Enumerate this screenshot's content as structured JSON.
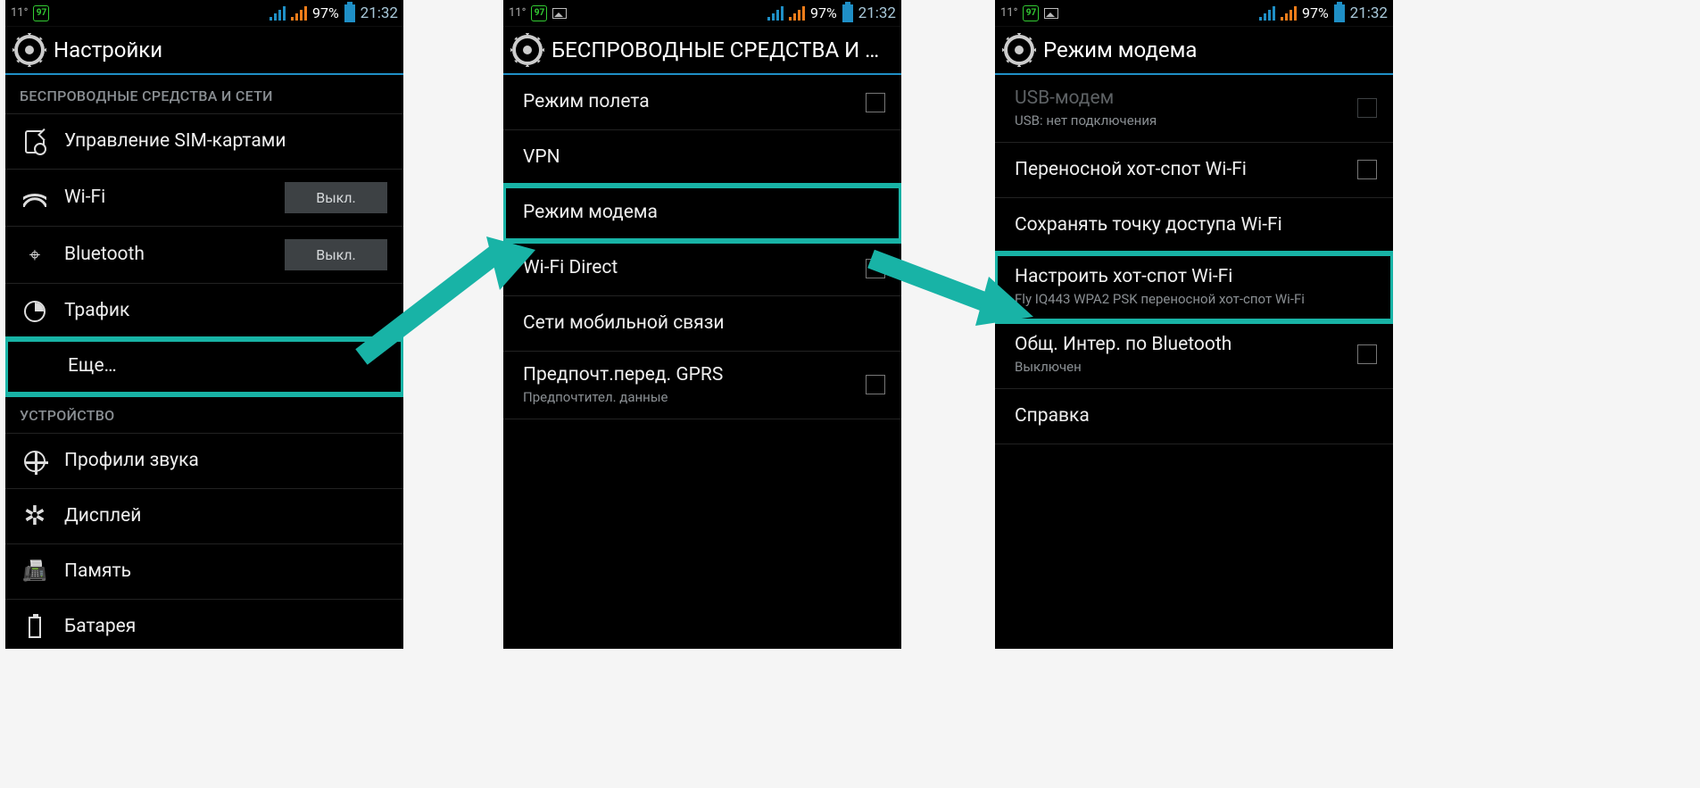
{
  "status": {
    "temp": "11°",
    "badge": "97",
    "battery_pct": "97%",
    "time": "21:32"
  },
  "screens": [
    {
      "title": "Настройки",
      "showPicIcon": false,
      "sections": [
        {
          "header": "БЕСПРОВОДНЫЕ СРЕДСТВА И СЕТИ",
          "items": [
            {
              "icon": "sim",
              "label": "Управление SIM-картами"
            },
            {
              "icon": "wifi",
              "label": "Wi-Fi",
              "toggle": "Выкл."
            },
            {
              "icon": "bt",
              "label": "Bluetooth",
              "toggle": "Выкл."
            },
            {
              "icon": "data",
              "label": "Трафик"
            },
            {
              "icon": "",
              "label": "Еще…",
              "highlight": true
            }
          ]
        },
        {
          "header": "УСТРОЙСТВО",
          "items": [
            {
              "icon": "audio",
              "label": "Профили звука"
            },
            {
              "icon": "disp",
              "label": "Дисплей"
            },
            {
              "icon": "mem",
              "label": "Память"
            },
            {
              "icon": "bat",
              "label": "Батарея"
            }
          ]
        }
      ]
    },
    {
      "title": "БЕСПРОВОДНЫЕ СРЕДСТВА И СЕ…",
      "showPicIcon": true,
      "items": [
        {
          "label": "Режим полета",
          "checkbox": true
        },
        {
          "label": "VPN"
        },
        {
          "label": "Режим модема",
          "highlight": true
        },
        {
          "label": "Wi-Fi Direct",
          "checkbox": true
        },
        {
          "label": "Сети мобильной связи"
        },
        {
          "label": "Предпочт.перед. GPRS",
          "sub": "Предпочтител. данные",
          "checkbox": true
        }
      ]
    },
    {
      "title": "Режим модема",
      "showPicIcon": true,
      "items": [
        {
          "label": "USB-модем",
          "sub": "USB: нет подключения",
          "checkbox": true,
          "disabled": true
        },
        {
          "label": "Переносной хот-спот Wi-Fi",
          "checkbox": true
        },
        {
          "label": "Сохранять точку доступа Wi-Fi"
        },
        {
          "label": "Настроить хот-спот Wi-Fi",
          "sub": "Fly IQ443 WPA2 PSK переносной хот-спот Wi-Fi",
          "highlight": true
        },
        {
          "label": "Общ. Интер. по Bluetooth",
          "sub": "Выключен",
          "checkbox": true
        },
        {
          "label": "Справка"
        }
      ]
    }
  ],
  "highlight_color": "#18b3a6"
}
